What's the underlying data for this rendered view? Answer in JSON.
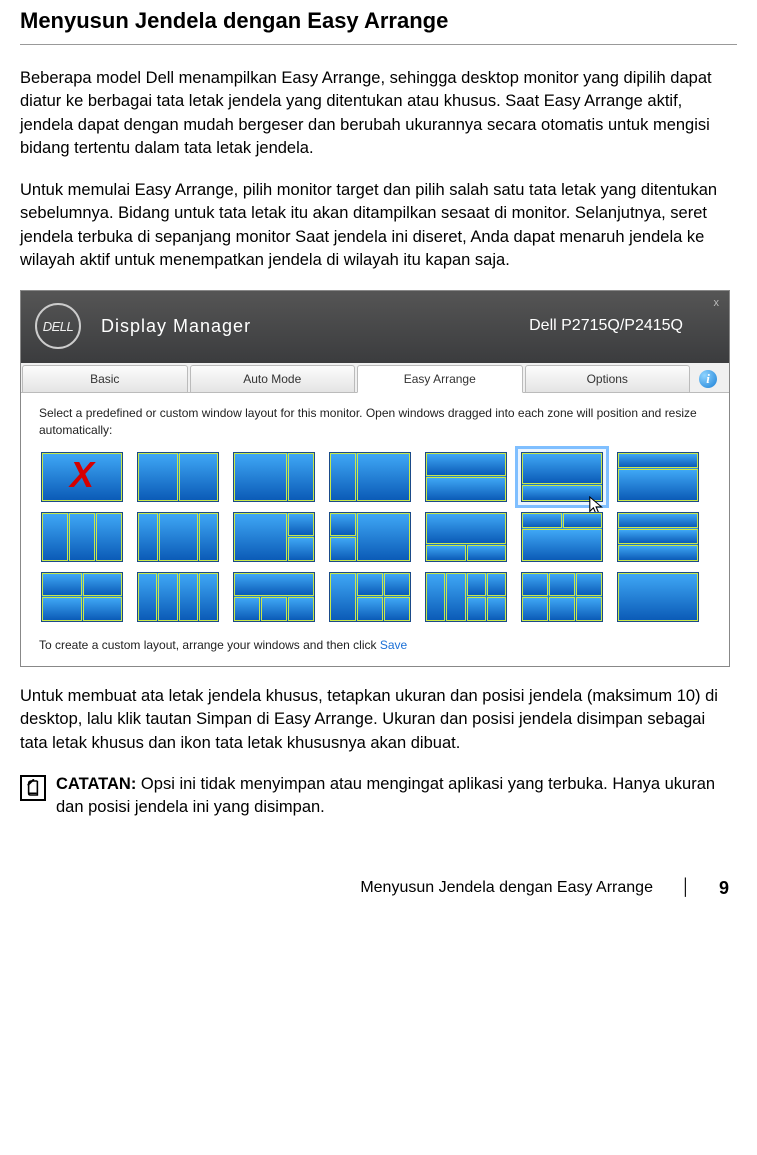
{
  "doc": {
    "heading": "Menyusun Jendela dengan Easy Arrange",
    "para1": "Beberapa model Dell menampilkan Easy Arrange, sehingga desktop monitor yang dipilih dapat diatur ke berbagai tata letak jendela yang ditentukan atau khusus. Saat Easy Arrange aktif, jendela dapat dengan mudah bergeser dan berubah ukurannya secara otomatis untuk mengisi bidang tertentu dalam tata letak jendela.",
    "para2": "Untuk memulai Easy Arrange, pilih monitor target dan pilih salah satu tata letak yang ditentukan sebelumnya. Bidang untuk tata letak itu akan ditampilkan sesaat di monitor. Selanjutnya, seret jendela terbuka di sepanjang monitor Saat jendela ini diseret, Anda dapat menaruh jendela ke wilayah aktif untuk menempatkan jendela di wilayah itu kapan saja.",
    "para3": "Untuk membuat ata letak jendela khusus, tetapkan ukuran dan posisi jendela (maksimum 10) di desktop, lalu klik tautan Simpan di Easy Arrange. Ukuran dan posisi jendela disimpan sebagai tata letak khusus dan ikon tata letak khususnya akan dibuat.",
    "note_label": "CATATAN:",
    "note_text": " Opsi ini tidak menyimpan atau mengingat aplikasi yang terbuka. Hanya ukuran dan posisi jendela ini yang disimpan."
  },
  "app": {
    "logo_text": "DELL",
    "title": "Display Manager",
    "model": "Dell P2715Q/P2415Q",
    "close": "x",
    "tabs": {
      "basic": "Basic",
      "auto_mode": "Auto Mode",
      "easy_arrange": "Easy Arrange",
      "options": "Options"
    },
    "info_icon": "i",
    "instruction": "Select a predefined or custom window layout for this monitor. Open windows dragged into each zone will position and resize automatically:",
    "save_prefix": "To create a custom layout, arrange your windows and then click ",
    "save_link": "Save"
  },
  "footer": {
    "title": "Menyusun Jendela dengan Easy Arrange",
    "sep": "│",
    "page": "9"
  }
}
